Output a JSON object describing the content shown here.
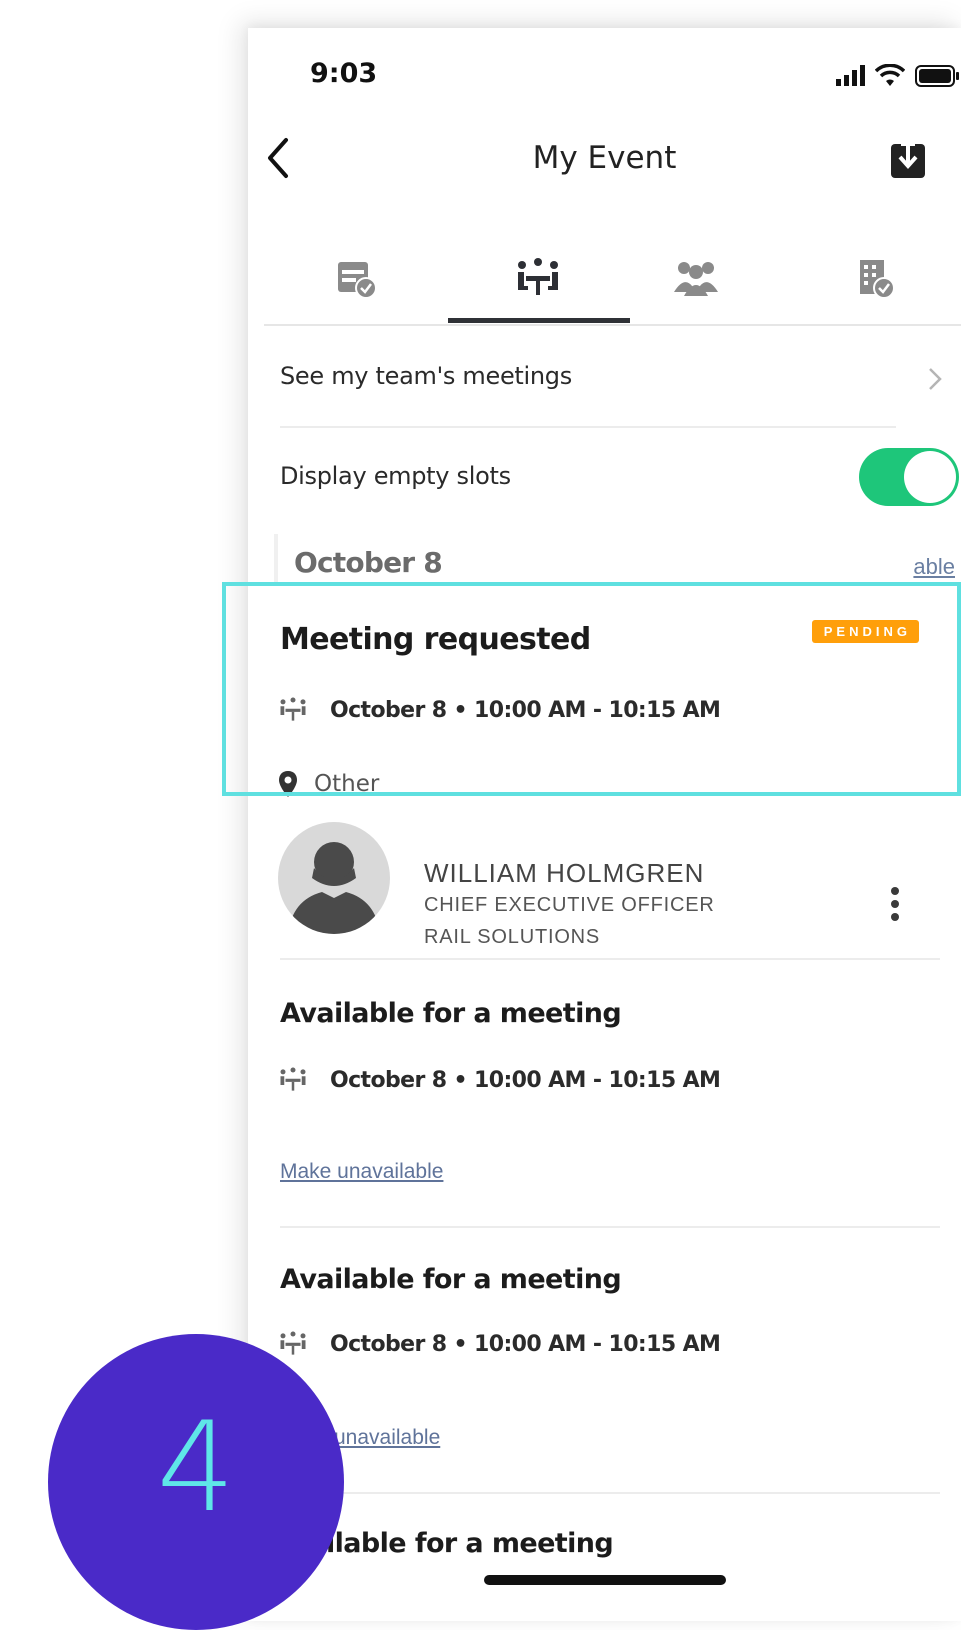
{
  "status_bar": {
    "time": "9:03"
  },
  "nav": {
    "title": "My Event"
  },
  "tabs": [
    {
      "icon": "calendar-check-icon"
    },
    {
      "icon": "meeting-table-icon",
      "active": true
    },
    {
      "icon": "people-group-icon"
    },
    {
      "icon": "building-check-icon"
    }
  ],
  "rows": {
    "team_meetings_label": "See my team's meetings",
    "empty_slots_label": "Display empty slots",
    "empty_slots_on": true
  },
  "date_header": {
    "date": "October 8",
    "link_partial": "able"
  },
  "highlighted_meeting": {
    "title": "Meeting requested",
    "status": "PENDING",
    "datetime": "October 8 • 10:00 AM - 10:15 AM",
    "location": "Other"
  },
  "attendee": {
    "name": "WILLIAM HOLMGREN",
    "role": "CHIEF EXECUTIVE OFFICER",
    "company": "RAIL SOLUTIONS"
  },
  "slots": [
    {
      "title": "Available for a meeting",
      "datetime": "October 8 • 10:00 AM - 10:15 AM",
      "action": "Make unavailable"
    },
    {
      "title": "Available for a meeting",
      "datetime": "October 8 • 10:00 AM - 10:15 AM",
      "action_partial": "unavailable"
    },
    {
      "title_partial": "ilable for a meeting"
    }
  ],
  "step": {
    "number": "4"
  },
  "colors": {
    "toggle_on": "#1ec67a",
    "badge": "#ff9f0a",
    "highlight": "#5fe0e0",
    "step_circle": "#4a2ac8",
    "step_number": "#5fe6e8"
  }
}
